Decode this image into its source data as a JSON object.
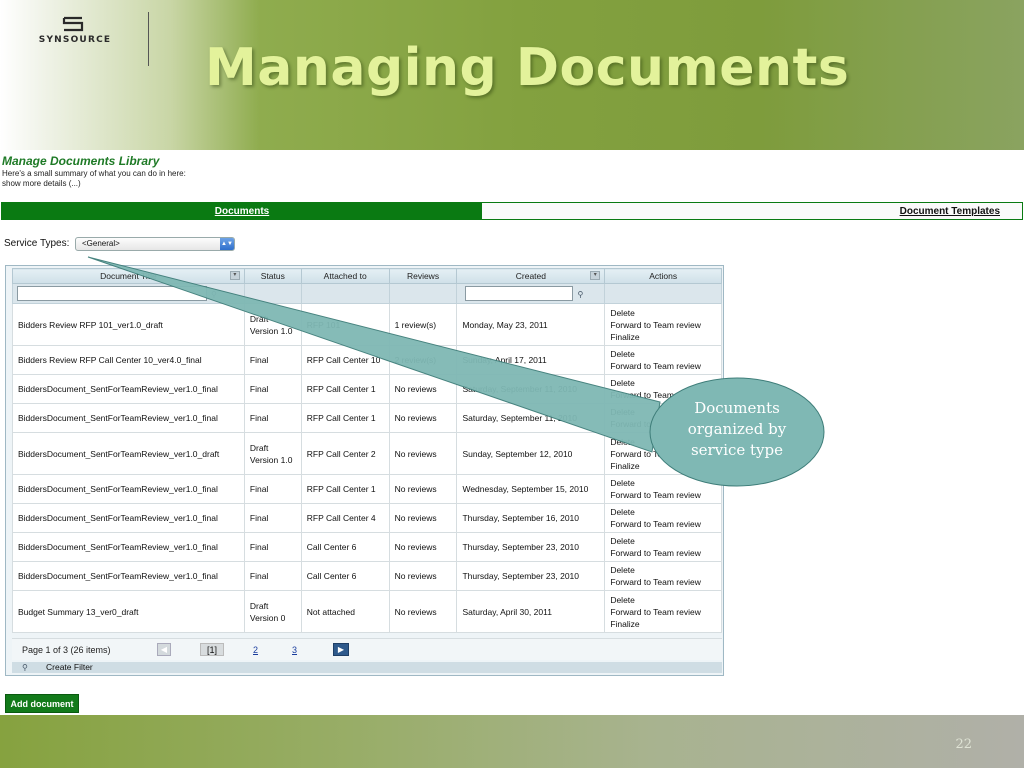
{
  "slide": {
    "logo_text": "SYNSOURCE",
    "title": "Managing Documents",
    "page_number": "22"
  },
  "library": {
    "title": "Manage Documents Library",
    "summary": "Here's a small summary of what you can do in here:",
    "more_details": "show more details (...)"
  },
  "tabs": [
    {
      "label": "Documents",
      "active": true
    },
    {
      "label": "Document Templates",
      "active": false
    }
  ],
  "service_types": {
    "label": "Service Types:",
    "selected": "<General>"
  },
  "grid": {
    "columns": [
      "Document Title",
      "Status",
      "Attached to",
      "Reviews",
      "Created",
      "Actions"
    ],
    "rows": [
      {
        "title": "Bidders Review RFP 101_ver1.0_draft",
        "status": [
          "Draft",
          "Version 1.0"
        ],
        "attached": "RFP 101",
        "reviews": "1 review(s)",
        "created": "Monday, May 23, 2011",
        "actions": [
          "Delete",
          "Forward to Team review",
          "Finalize"
        ]
      },
      {
        "title": "Bidders Review RFP Call Center 10_ver4.0_final",
        "status": [
          "Final"
        ],
        "attached": "RFP Call Center 10",
        "reviews": "2 review(s)",
        "created": "Sunday, April 17, 2011",
        "actions": [
          "Delete",
          "Forward to Team review"
        ]
      },
      {
        "title": "BiddersDocument_SentForTeamReview_ver1.0_final",
        "status": [
          "Final"
        ],
        "attached": "RFP Call Center 1",
        "reviews": "No reviews",
        "created": "Saturday, September 11, 2010",
        "actions": [
          "Delete",
          "Forward to Team review"
        ]
      },
      {
        "title": "BiddersDocument_SentForTeamReview_ver1.0_final",
        "status": [
          "Final"
        ],
        "attached": "RFP Call Center 1",
        "reviews": "No reviews",
        "created": "Saturday, September 11, 2010",
        "actions": [
          "Delete",
          "Forward to Team review"
        ]
      },
      {
        "title": "BiddersDocument_SentForTeamReview_ver1.0_draft",
        "status": [
          "Draft",
          "Version 1.0"
        ],
        "attached": "RFP Call Center 2",
        "reviews": "No reviews",
        "created": "Sunday, September 12, 2010",
        "actions": [
          "Delete",
          "Forward to Team review",
          "Finalize"
        ]
      },
      {
        "title": "BiddersDocument_SentForTeamReview_ver1.0_final",
        "status": [
          "Final"
        ],
        "attached": "RFP Call Center 1",
        "reviews": "No reviews",
        "created": "Wednesday, September 15, 2010",
        "actions": [
          "Delete",
          "Forward to Team review"
        ]
      },
      {
        "title": "BiddersDocument_SentForTeamReview_ver1.0_final",
        "status": [
          "Final"
        ],
        "attached": "RFP Call Center 4",
        "reviews": "No reviews",
        "created": "Thursday, September 16, 2010",
        "actions": [
          "Delete",
          "Forward to Team review"
        ]
      },
      {
        "title": "BiddersDocument_SentForTeamReview_ver1.0_final",
        "status": [
          "Final"
        ],
        "attached": "Call Center 6",
        "reviews": "No reviews",
        "created": "Thursday, September 23, 2010",
        "actions": [
          "Delete",
          "Forward to Team review"
        ]
      },
      {
        "title": "BiddersDocument_SentForTeamReview_ver1.0_final",
        "status": [
          "Final"
        ],
        "attached": "Call Center 6",
        "reviews": "No reviews",
        "created": "Thursday, September 23, 2010",
        "actions": [
          "Delete",
          "Forward to Team review"
        ]
      },
      {
        "title": "Budget Summary 13_ver0_draft",
        "status": [
          "Draft",
          "Version 0"
        ],
        "attached": "Not attached",
        "reviews": "No reviews",
        "created": "Saturday, April 30, 2011",
        "actions": [
          "Delete",
          "Forward to Team review",
          "Finalize"
        ]
      }
    ],
    "pager": {
      "info": "Page 1 of 3 (26 items)",
      "current": "[1]",
      "page2": "2",
      "page3": "3"
    },
    "create_filter": "Create Filter"
  },
  "add_document": "Add document",
  "callout": {
    "lines": [
      "Documents",
      "organized by",
      "service type"
    ],
    "color": "#7fb8b4"
  },
  "colors": {
    "tab_green": "#0a7a12",
    "title_green": "#e3f29b",
    "library_title": "#1e7a26"
  }
}
